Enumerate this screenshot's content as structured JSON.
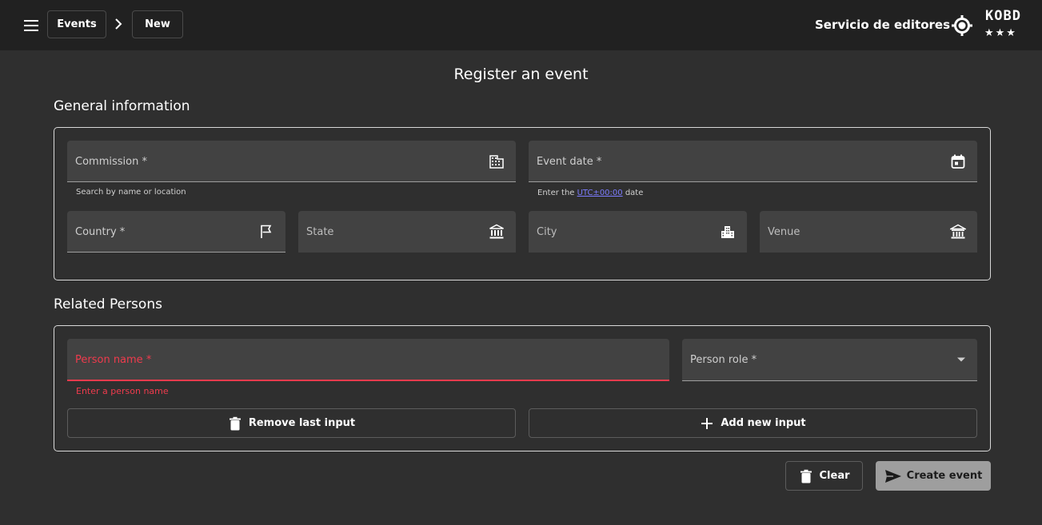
{
  "header": {
    "breadcrumb": [
      {
        "label": "Events"
      },
      {
        "label": "New"
      }
    ],
    "service_name": "Servicio de editores",
    "logo_text": "KOBD",
    "logo_stars": "★★★"
  },
  "page": {
    "title": "Register an event"
  },
  "general": {
    "title": "General information",
    "commission": {
      "label": "Commission *",
      "icon": "building-icon",
      "hint": "Search by name or location"
    },
    "event_date": {
      "label": "Event date *",
      "icon": "calendar-icon",
      "hint_prefix": "Enter the ",
      "hint_link": "UTC±00:00",
      "hint_suffix": " date"
    },
    "country": {
      "label": "Country *",
      "icon": "flag-icon"
    },
    "state": {
      "label": "State",
      "icon": "institution-icon"
    },
    "city": {
      "label": "City",
      "icon": "city-icon"
    },
    "venue": {
      "label": "Venue",
      "icon": "museum-icon"
    }
  },
  "persons": {
    "title": "Related Persons",
    "person_name": {
      "label": "Person name *",
      "error": "Enter a person name"
    },
    "person_role": {
      "label": "Person role *"
    },
    "remove_label": "Remove last input",
    "add_label": "Add new input"
  },
  "actions": {
    "clear_label": "Clear",
    "create_label": "Create event"
  },
  "colors": {
    "topbar": "#212121",
    "background": "#2f2f2f",
    "field": "#424242",
    "error": "#ef3b4d",
    "link": "#7c7cff",
    "create_button": "#9e9e9e"
  }
}
